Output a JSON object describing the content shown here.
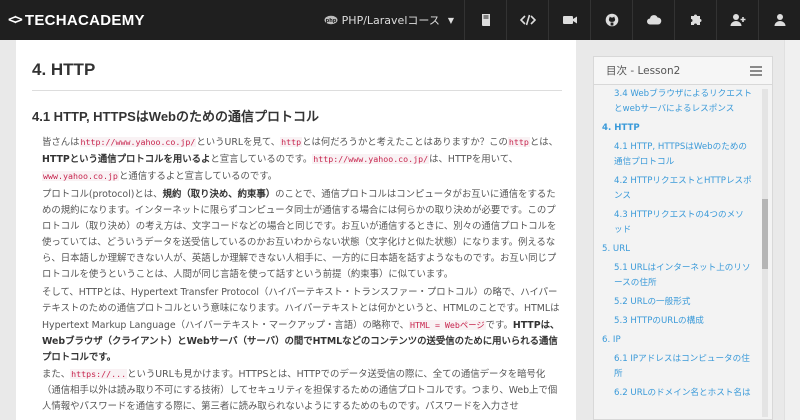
{
  "brand": {
    "name": "TECHACADEMY"
  },
  "nav": {
    "course_label": "PHP/Laravelコース",
    "buttons": [
      "book-icon",
      "code-icon",
      "video-icon",
      "github-icon",
      "cloud-icon",
      "puzzle-icon",
      "add-user-icon",
      "user-icon"
    ]
  },
  "content": {
    "section_title": "4. HTTP",
    "sub_title": "4.1 HTTP, HTTPSはWebのための通信プロトコル",
    "p1": {
      "t1": "皆さんは",
      "c1": "http://www.yahoo.co.jp/",
      "t2": "というURLを見て、",
      "c2": "http",
      "t3": "とは何だろうかと考えたことはありますか？この",
      "c3": "http",
      "t4": "とは、",
      "b1": "HTTPという通信プロトコルを用いるよ",
      "t5": "と宣言しているのです。",
      "c4": "http://www.yahoo.co.jp/",
      "t6": "は、HTTPを用いて、",
      "c5": "www.yahoo.co.jp",
      "t7": "と通信するよと宣言しているのです。"
    },
    "p2": {
      "t1": "プロトコル(protocol)とは、",
      "b1": "規約（取り決め、約束事）",
      "t2": "のことで、通信プロトコルはコンピュータがお互いに通信をするための規約になります。インターネットに限らずコンピュータ同士が通信する場合には何らかの取り決めが必要です。このプロトコル（取り決め）の考え方は、文字コードなどの場合と同じです。お互いが通信するときに、別々の通信プロトコルを使っていては、どういうデータを送受信しているのかお互いわからない状態（文字化けと似た状態）になります。例えるなら、日本語しか理解できない人が、英語しか理解できない人相手に、一方的に日本語を話すようなものです。お互い同じプロトコルを使うということは、人間が同じ言語を使って話すという前提（約束事）に似ています。"
    },
    "p3": {
      "t1": "そして、HTTPとは、Hypertext Transfer Protocol（ハイパーテキスト・トランスファー・プロトコル）の略で、ハイパーテキストのための通信プロトコルという意味になります。ハイパーテキストとは何かというと、HTMLのことです。HTMLはHypertext Markup Language（ハイパーテキスト・マークアップ・言語）の略称で、",
      "c1": "HTML = Webページ",
      "t2": "です。",
      "b1": "HTTPは、Webブラウザ（クライアント）とWebサーバ（サーバ）の間でHTMLなどのコンテンツの送受信のために用いられる通信プロトコルです。"
    },
    "p4": {
      "t1": "また、",
      "c1": "https://...",
      "t2": "というURLも見かけます。HTTPSとは、HTTPでのデータ送受信の際に、全ての通信データを暗号化（通信相手以外は読み取り不可にする技術）してセキュリティを担保するための通信プロトコルです。つまり、Web上で個人情報やパスワードを通信する際に、第三者に読み取られないようにするためのものです。パスワードを入力させ"
    }
  },
  "toc": {
    "title": "目次 - Lesson2",
    "items": [
      {
        "label": "3.4 Webブラウザによるリクエストとwebサーバによるレスポンス",
        "level": 2
      },
      {
        "label": "4. HTTP",
        "level": 1
      },
      {
        "label": "4.1 HTTP, HTTPSはWebのための通信プロトコル",
        "level": 2
      },
      {
        "label": "4.2 HTTPリクエストとHTTPレスポンス",
        "level": 2
      },
      {
        "label": "4.3 HTTPリクエストの4つのメソッド",
        "level": 2
      },
      {
        "label": "5. URL",
        "level": 1
      },
      {
        "label": "5.1 URLはインターネット上のリソースの住所",
        "level": 2
      },
      {
        "label": "5.2 URLの一般形式",
        "level": 2
      },
      {
        "label": "5.3 HTTPのURLの構成",
        "level": 2
      },
      {
        "label": "6. IP",
        "level": 1
      },
      {
        "label": "6.1 IPアドレスはコンピュータの住所",
        "level": 2
      },
      {
        "label": "6.2 URLのドメイン名とホスト名は",
        "level": 2
      }
    ]
  }
}
